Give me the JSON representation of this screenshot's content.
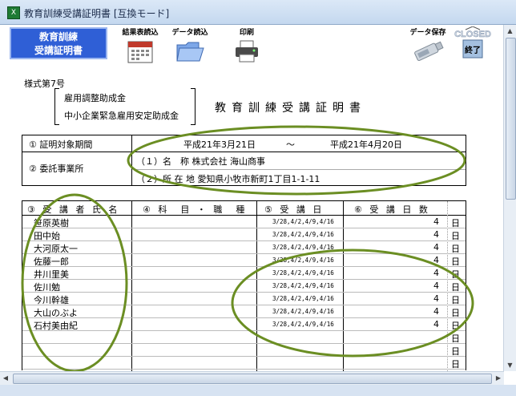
{
  "window": {
    "title": "教育訓練受講証明書  [互換モード]",
    "icon": "excel-icon"
  },
  "toolbar": {
    "brand": "教育訓練\n受講証明書",
    "buttons": [
      {
        "label": "結果表読込",
        "icon": "calendar-icon"
      },
      {
        "label": "データ読込",
        "icon": "folder-icon"
      },
      {
        "label": "印刷",
        "icon": "printer-icon"
      },
      {
        "label": "データ保存",
        "icon": "usb-drive-icon"
      },
      {
        "label": "終了",
        "icon": "closed-sign-icon",
        "badge": "CLOSED"
      }
    ]
  },
  "form": {
    "form_number": "様式第7号",
    "subsidy_1": "雇用調整助成金",
    "subsidy_2": "中小企業緊急雇用安定助成金",
    "title": "教育訓練受講証明書",
    "period_label": "① 証明対象期間",
    "period_start": "平成21年3月21日",
    "period_sep": "～",
    "period_end": "平成21年4月20日",
    "entrusted_label": "② 委託事業所",
    "company_name_line": "（１）名　称  株式会社  海山商事",
    "company_address_line": "（２）所 在 地  愛知県小牧市新町1丁目1-1-11"
  },
  "table": {
    "headers": [
      "③ 受 講 者 氏 名",
      "④ 科　目 ・ 職　種",
      "⑤ 受 講 日",
      "⑥ 受 講 日 数"
    ],
    "rows": [
      {
        "name": "笹原英樹",
        "dates": "3/28,4/2,4/9,4/16",
        "days": "4",
        "unit": "日"
      },
      {
        "name": "田中始",
        "dates": "3/28,4/2,4/9,4/16",
        "days": "4",
        "unit": "日"
      },
      {
        "name": "大河原太一",
        "dates": "3/28,4/2,4/9,4/16",
        "days": "4",
        "unit": "日"
      },
      {
        "name": "佐藤一郎",
        "dates": "3/28,4/2,4/9,4/16",
        "days": "4",
        "unit": "日"
      },
      {
        "name": "井川里美",
        "dates": "3/28,4/2,4/9,4/16",
        "days": "4",
        "unit": "日"
      },
      {
        "name": "佐川勉",
        "dates": "3/28,4/2,4/9,4/16",
        "days": "4",
        "unit": "日"
      },
      {
        "name": "今川幹雄",
        "dates": "3/28,4/2,4/9,4/16",
        "days": "4",
        "unit": "日"
      },
      {
        "name": "大山のぶよ",
        "dates": "3/28,4/2,4/9,4/16",
        "days": "4",
        "unit": "日"
      },
      {
        "name": "石村美由紀",
        "dates": "3/28,4/2,4/9,4/16",
        "days": "4",
        "unit": "日"
      },
      {
        "name": "",
        "dates": "",
        "days": "",
        "unit": "日"
      },
      {
        "name": "",
        "dates": "",
        "days": "",
        "unit": "日"
      },
      {
        "name": "",
        "dates": "",
        "days": "",
        "unit": "日"
      }
    ]
  },
  "colors": {
    "oval": "#6b8e23",
    "brand": "#2f5fd6"
  }
}
